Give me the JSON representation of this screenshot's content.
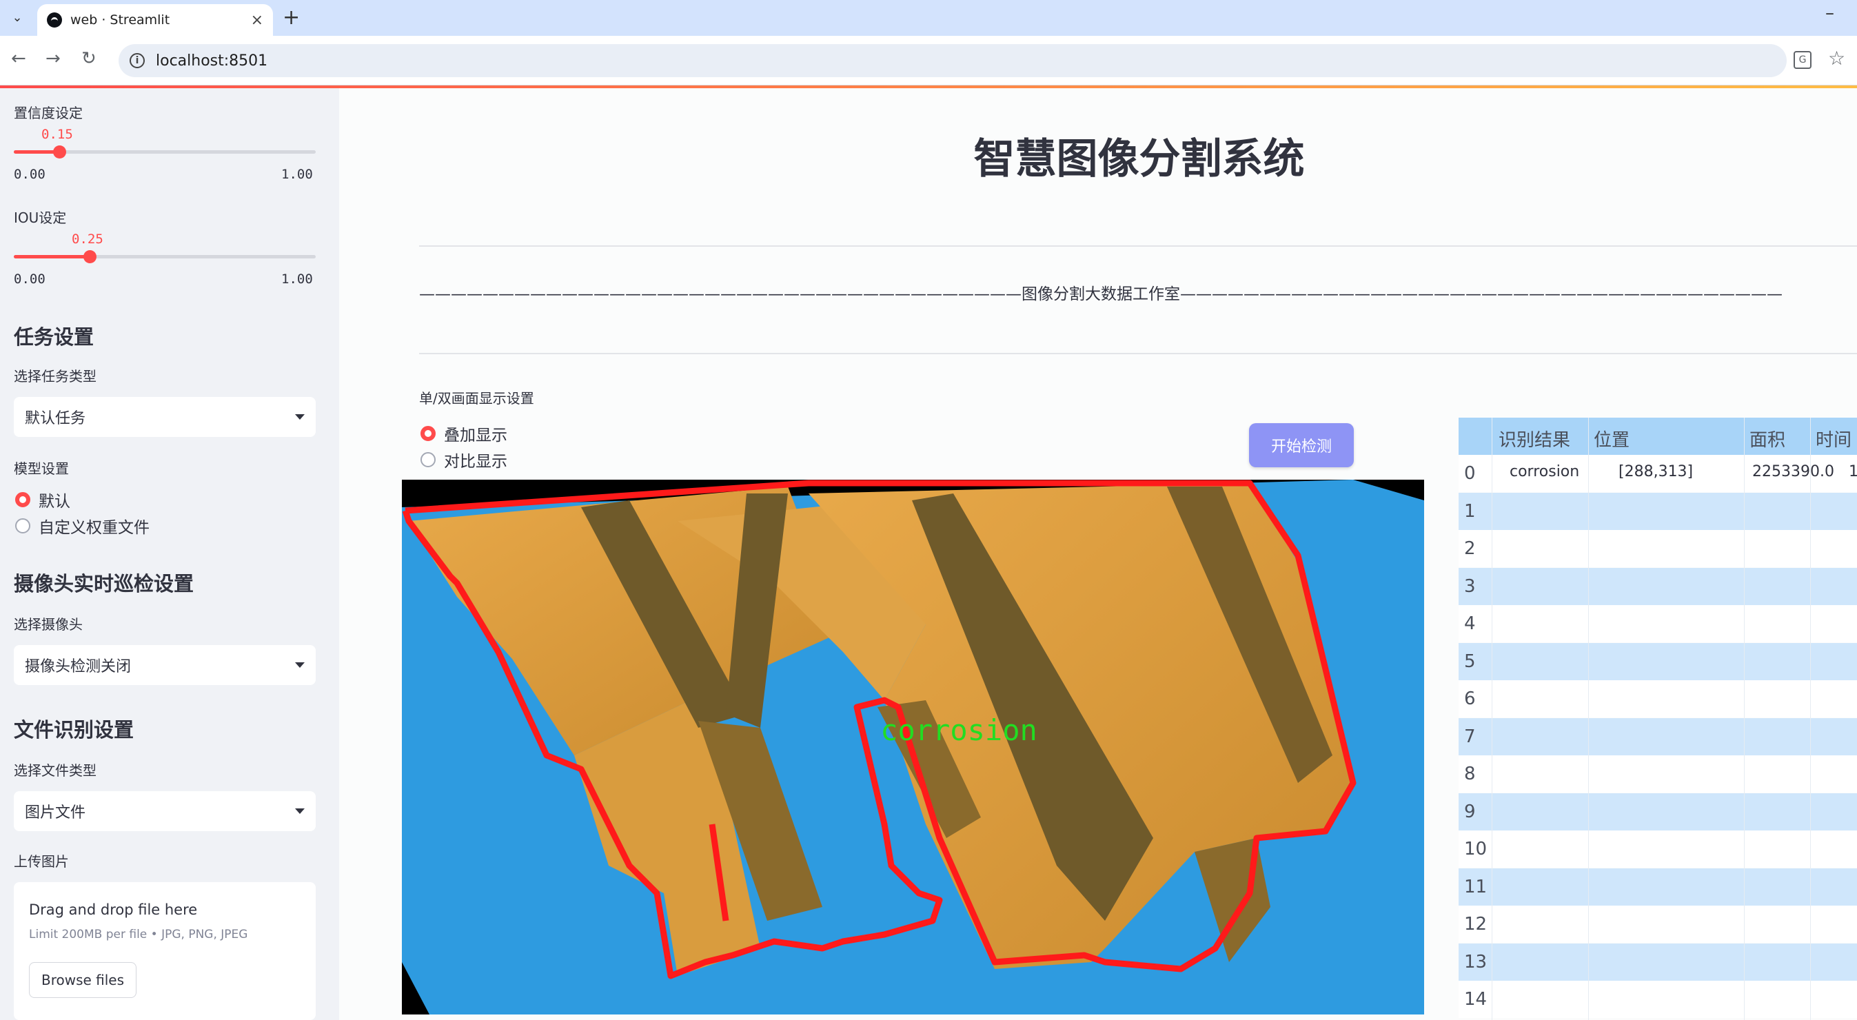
{
  "browser": {
    "tab_title": "web · Streamlit",
    "url": "localhost:8501"
  },
  "sidebar": {
    "confidence": {
      "label": "置信度设定",
      "value": "0.15",
      "min": "0.00",
      "max": "1.00",
      "fraction": 0.15
    },
    "iou": {
      "label": "IOU设定",
      "value": "0.25",
      "min": "0.00",
      "max": "1.00",
      "fraction": 0.25
    },
    "task": {
      "heading": "任务设置",
      "label": "选择任务类型",
      "selected": "默认任务"
    },
    "model": {
      "label": "模型设置",
      "options": [
        "默认",
        "自定义权重文件"
      ],
      "selected_index": 0
    },
    "camera": {
      "heading": "摄像头实时巡检设置",
      "label": "选择摄像头",
      "selected": "摄像头检测关闭"
    },
    "file": {
      "heading": "文件识别设置",
      "label": "选择文件类型",
      "selected": "图片文件"
    },
    "upload": {
      "label": "上传图片",
      "drop_text": "Drag and drop file here",
      "limit_text": "Limit 200MB per file • JPG, PNG, JPEG",
      "browse_label": "Browse files"
    }
  },
  "main": {
    "title": "智慧图像分割系统",
    "subtitle_line": "——————————————————————————————————————图像分割大数据工作室——————————————————————————————————————",
    "display_label": "单/双画面显示设置",
    "display_options": [
      "叠加显示",
      "对比显示"
    ],
    "display_selected_index": 0,
    "detect_button": "开始检测",
    "image_label": "corrosion"
  },
  "results_table": {
    "columns": [
      "识别结果",
      "位置",
      "面积",
      "时间"
    ],
    "row_indices": [
      "0",
      "1",
      "2",
      "3",
      "4",
      "5",
      "6",
      "7",
      "8",
      "9",
      "10",
      "11",
      "12",
      "13",
      "14"
    ],
    "rows": [
      {
        "result": "corrosion",
        "position": "[288,313]",
        "area": "2253390.0",
        "time": "1"
      }
    ]
  },
  "colors": {
    "accent": "#ff4b4b",
    "button": "#8e94f5",
    "table_header": "#a8d4f8",
    "table_stripe": "#cfe6fb",
    "sidebar_bg": "#f0f2f6"
  }
}
